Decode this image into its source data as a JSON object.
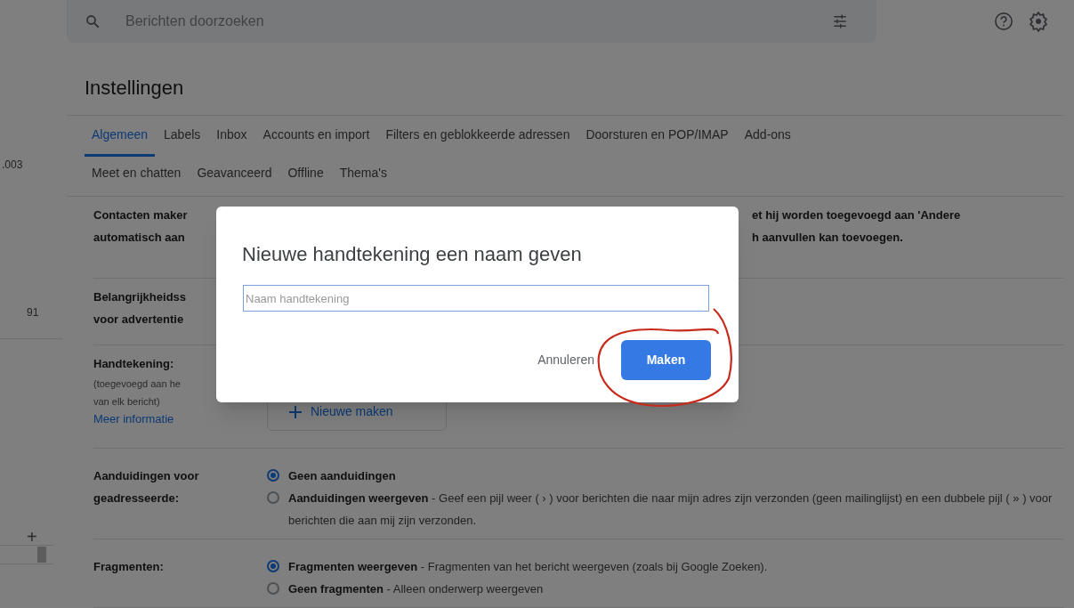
{
  "search": {
    "placeholder": "Berichten doorzoeken"
  },
  "sidebar": {
    "counts": [
      ".003",
      "91"
    ],
    "add_label": "+"
  },
  "title": "Instellingen",
  "tabs": [
    {
      "label": "Algemeen",
      "selected": true
    },
    {
      "label": "Labels",
      "selected": false
    },
    {
      "label": "Inbox",
      "selected": false
    },
    {
      "label": "Accounts en import",
      "selected": false
    },
    {
      "label": "Filters en geblokkeerde adressen",
      "selected": false
    },
    {
      "label": "Doorsturen en POP/IMAP",
      "selected": false
    },
    {
      "label": "Add-ons",
      "selected": false
    },
    {
      "label": "Meet en chatten",
      "selected": false
    },
    {
      "label": "Geavanceerd",
      "selected": false
    },
    {
      "label": "Offline",
      "selected": false
    },
    {
      "label": "Thema's",
      "selected": false
    }
  ],
  "settings": [
    {
      "kind": "text",
      "label": [
        "Contacten maker",
        "automatisch aan"
      ],
      "text": [
        "et hij worden toegevoegd aan 'Andere",
        "h aanvullen kan toevoegen."
      ]
    },
    {
      "kind": "text",
      "label": [
        "Belangrijkheidss",
        "voor advertentie"
      ]
    },
    {
      "kind": "signature",
      "label": [
        "Handtekening:"
      ],
      "notes": [
        "(toegevoegd aan he",
        "van elk bericht)"
      ],
      "link": "Meer informatie",
      "button": "Nieuwe maken"
    },
    {
      "kind": "radio",
      "label": [
        "Aanduidingen voor",
        "geadresseerde:"
      ],
      "options": [
        {
          "title": "Geen aanduidingen",
          "selected": true
        },
        {
          "title": "Aanduidingen weergeven",
          "text": " - Geef een pijl weer ( › ) voor berichten die naar mijn adres zijn verzonden (geen mailinglijst) en een dubbele pijl ( » ) voor berichten die aan mij zijn verzonden.",
          "selected": false
        }
      ]
    },
    {
      "kind": "radio",
      "label": [
        "Fragmenten:"
      ],
      "options": [
        {
          "title": "Fragmenten weergeven",
          "text": " - Fragmenten van het bericht weergeven (zoals bij Google Zoeken).",
          "selected": true
        },
        {
          "title": "Geen fragmenten",
          "text": " - Alleen onderwerp weergeven",
          "selected": false
        }
      ]
    }
  ],
  "dialog": {
    "title": "Nieuwe handtekening een naam geven",
    "placeholder": "Naam handtekening",
    "cancel": "Annuleren",
    "confirm": "Maken"
  }
}
